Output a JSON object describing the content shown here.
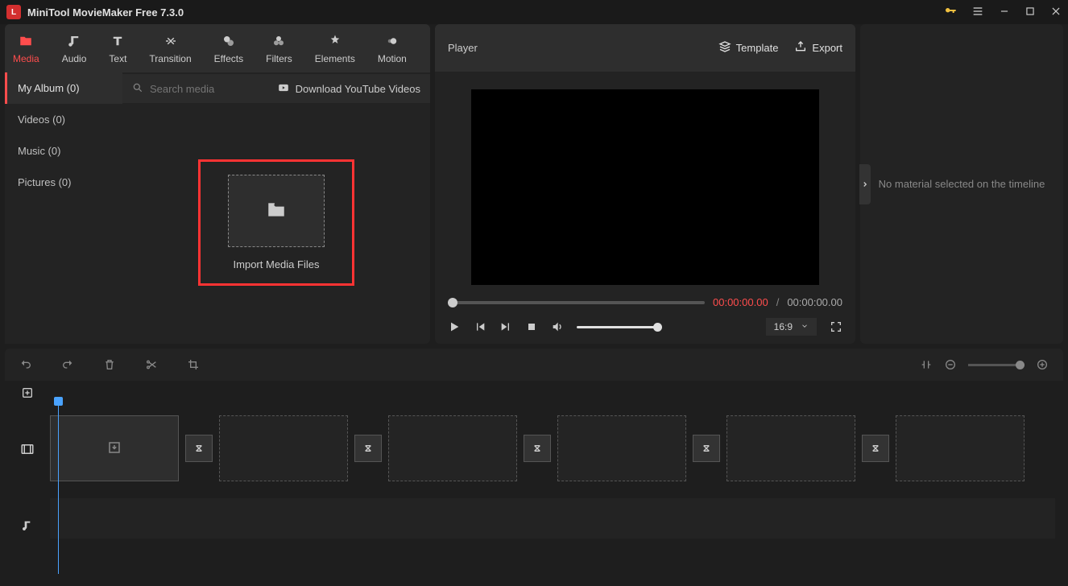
{
  "titlebar": {
    "title": "MiniTool MovieMaker Free 7.3.0"
  },
  "tabs": {
    "media": "Media",
    "audio": "Audio",
    "text": "Text",
    "transition": "Transition",
    "effects": "Effects",
    "filters": "Filters",
    "elements": "Elements",
    "motion": "Motion"
  },
  "mediaSidebar": {
    "album": "My Album (0)",
    "videos": "Videos (0)",
    "music": "Music (0)",
    "pictures": "Pictures (0)"
  },
  "search": {
    "placeholder": "Search media"
  },
  "download": {
    "label": "Download YouTube Videos"
  },
  "import": {
    "label": "Import Media Files"
  },
  "player": {
    "title": "Player",
    "template": "Template",
    "export": "Export",
    "time_current": "00:00:00.00",
    "time_sep": "/",
    "time_total": "00:00:00.00",
    "aspect": "16:9"
  },
  "tray": {
    "message": "No material selected on the timeline"
  }
}
